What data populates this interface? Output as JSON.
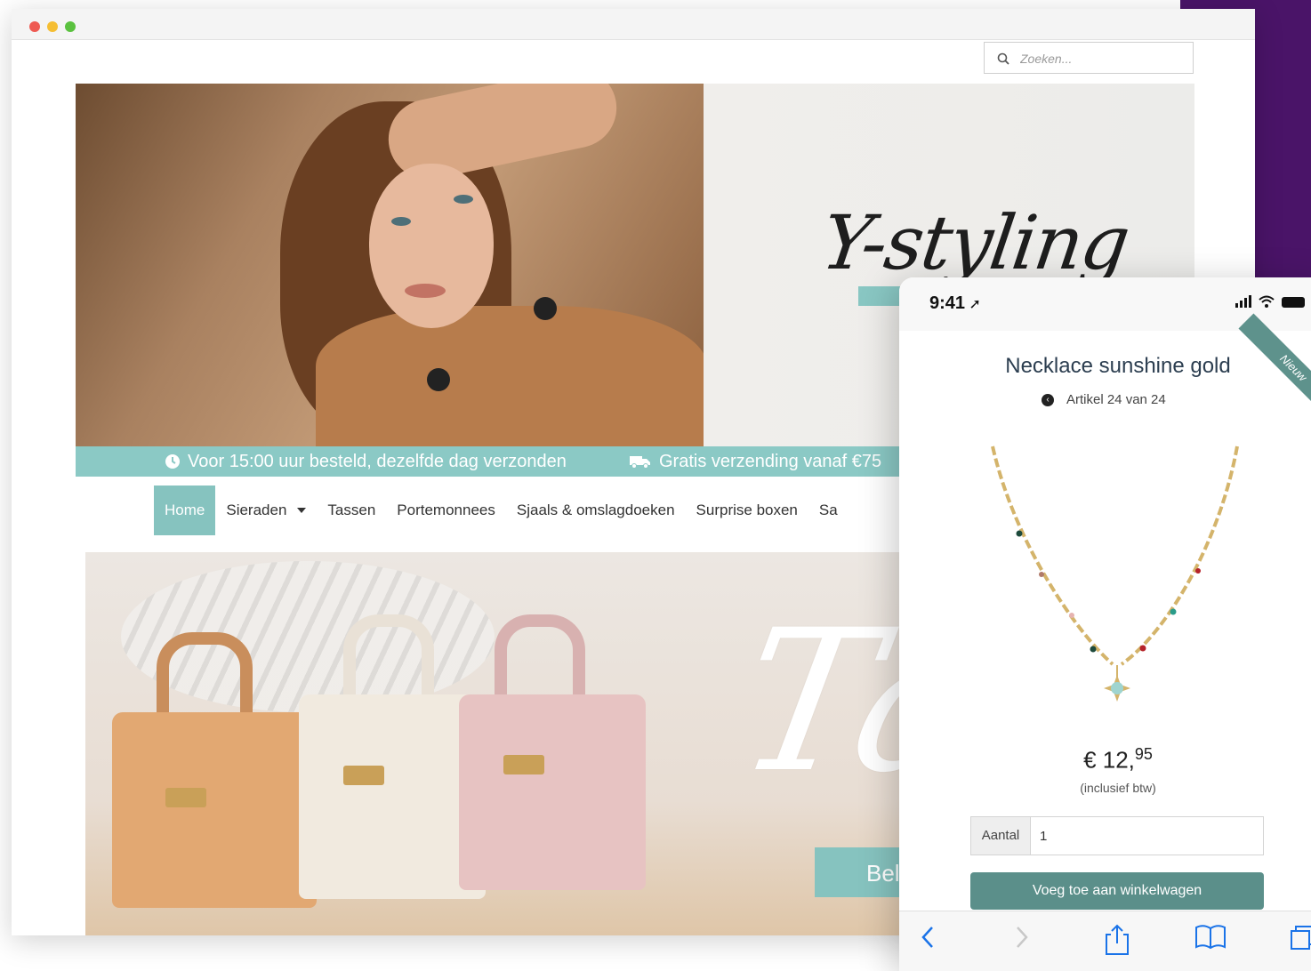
{
  "desktop": {
    "search": {
      "placeholder": "Zoeken..."
    },
    "hero": {
      "logo_text": "Y-styling"
    },
    "info_strip": {
      "item1": "Voor 15:00 uur besteld, dezelfde dag verzonden",
      "item2": "Gratis verzending vanaf €75"
    },
    "nav": {
      "items": [
        {
          "label": "Home",
          "active": true
        },
        {
          "label": "Sieraden",
          "has_dropdown": true
        },
        {
          "label": "Tassen"
        },
        {
          "label": "Portemonnees"
        },
        {
          "label": "Sjaals & omslagdoeken"
        },
        {
          "label": "Surprise boxen"
        },
        {
          "label": "Sa"
        }
      ]
    },
    "banner": {
      "script_text": "Ta",
      "button_label": "Bel"
    }
  },
  "phone": {
    "status": {
      "time": "9:41"
    },
    "ribbon": "Nieuw",
    "product": {
      "title": "Necklace sunshine gold",
      "counter": "Artikel 24 van 24",
      "price_main": "€ 12,",
      "price_cents": "95",
      "price_note": "(inclusief btw)",
      "qty_label": "Aantal",
      "qty_value": "1",
      "add_button": "Voeg toe aan winkelwagen"
    }
  },
  "colors": {
    "accent_teal": "#86c3bf",
    "button_teal": "#5b8f8a",
    "purple_backdrop": "#4a1468"
  }
}
